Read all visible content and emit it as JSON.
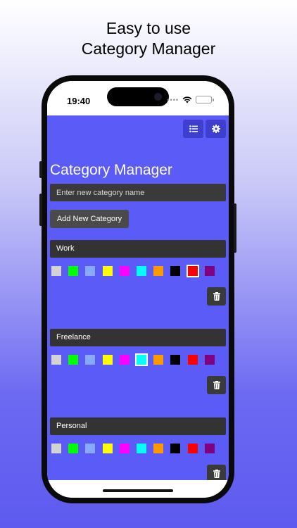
{
  "headline": {
    "line1": "Easy to use",
    "line2": "Category Manager"
  },
  "status_bar": {
    "time": "19:40"
  },
  "app": {
    "title": "Category Manager",
    "input_placeholder": "Enter new category name",
    "add_button": "Add New Category",
    "colors": [
      "#d3d3d3",
      "#00ff00",
      "#87a9ff",
      "#ffff00",
      "#ff00ff",
      "#00ffff",
      "#ff9900",
      "#000000",
      "#ff0000",
      "#800080"
    ],
    "categories": [
      {
        "name": "Work",
        "selected_color_index": 8
      },
      {
        "name": "Freelance",
        "selected_color_index": 5
      },
      {
        "name": "Personal",
        "selected_color_index": -1
      }
    ],
    "icons": {
      "list": "list-icon",
      "settings": "gear-icon",
      "delete": "trash-icon"
    }
  }
}
